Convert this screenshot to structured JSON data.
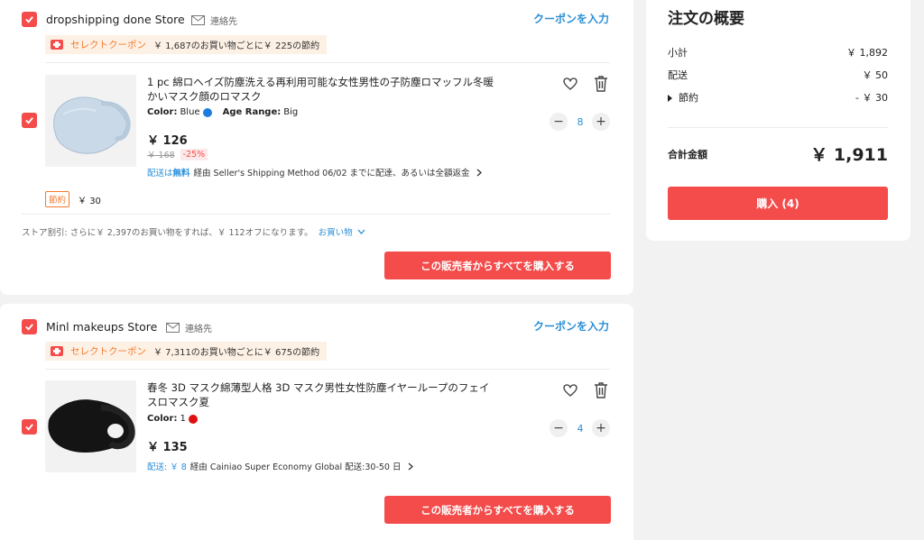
{
  "stores": [
    {
      "name": "dropshipping done Store",
      "contact": "連絡先",
      "coupon_link": "クーポンを入力",
      "select_coupon": {
        "label": "セレクトクーポン",
        "text": "￥ 1,687のお買い物ごとに￥ 225の節約"
      },
      "item": {
        "title": "1 pc 綿ロヘイズ防塵洗える再利用可能な女性男性の子防塵ロマッフル冬暖かいマスク顔のロマスク",
        "color_label": "Color:",
        "color_value": "Blue",
        "color_hex": "#1e7be0",
        "age_label": "Age Range:",
        "age_value": "Big",
        "price": "￥ 126",
        "orig_price": "￥ 168",
        "discount": "-25%",
        "shipping_prefix": "配送は",
        "shipping_free": "無料",
        "shipping_text": "経由 Seller's Shipping Method 06/02 までに配達、あるいは全額返金",
        "quantity": "8"
      },
      "savings_badge": "節約",
      "savings_amount": "￥ 30",
      "store_discount": "ストア割引: さらに￥ 2,397のお買い物をすれば、￥ 112オフになります。",
      "store_discount_link": "お買い物",
      "buy_all": "この販売者からすべてを購入する"
    },
    {
      "name": "Minl makeups Store",
      "contact": "連絡先",
      "coupon_link": "クーポンを入力",
      "select_coupon": {
        "label": "セレクトクーポン",
        "text": "￥ 7,311のお買い物ごとに￥ 675の節約"
      },
      "item": {
        "title": "春冬 3D マスク綿薄型人格 3D マスク男性女性防塵イヤーループのフェイスロマスク夏",
        "color_label": "Color:",
        "color_value": "1",
        "color_hex": "#e01010",
        "price": "￥ 135",
        "shipping_prefix": "配送: ￥ 8",
        "shipping_text": "経由 Cainiao Super Economy Global 配送:30-50 日",
        "quantity": "4"
      },
      "buy_all": "この販売者からすべてを購入する"
    }
  ],
  "summary": {
    "title": "注文の概要",
    "subtotal_label": "小計",
    "subtotal_value": "￥ 1,892",
    "shipping_label": "配送",
    "shipping_value": "￥ 50",
    "savings_label": "節約",
    "savings_value": "- ￥ 30",
    "total_label": "合計金額",
    "total_value": "￥ 1,911",
    "purchase_button": "購入 (4)"
  },
  "colors": {
    "accent": "#f44b4b",
    "link": "#2a8fd7",
    "coupon": "#f47a2e"
  }
}
